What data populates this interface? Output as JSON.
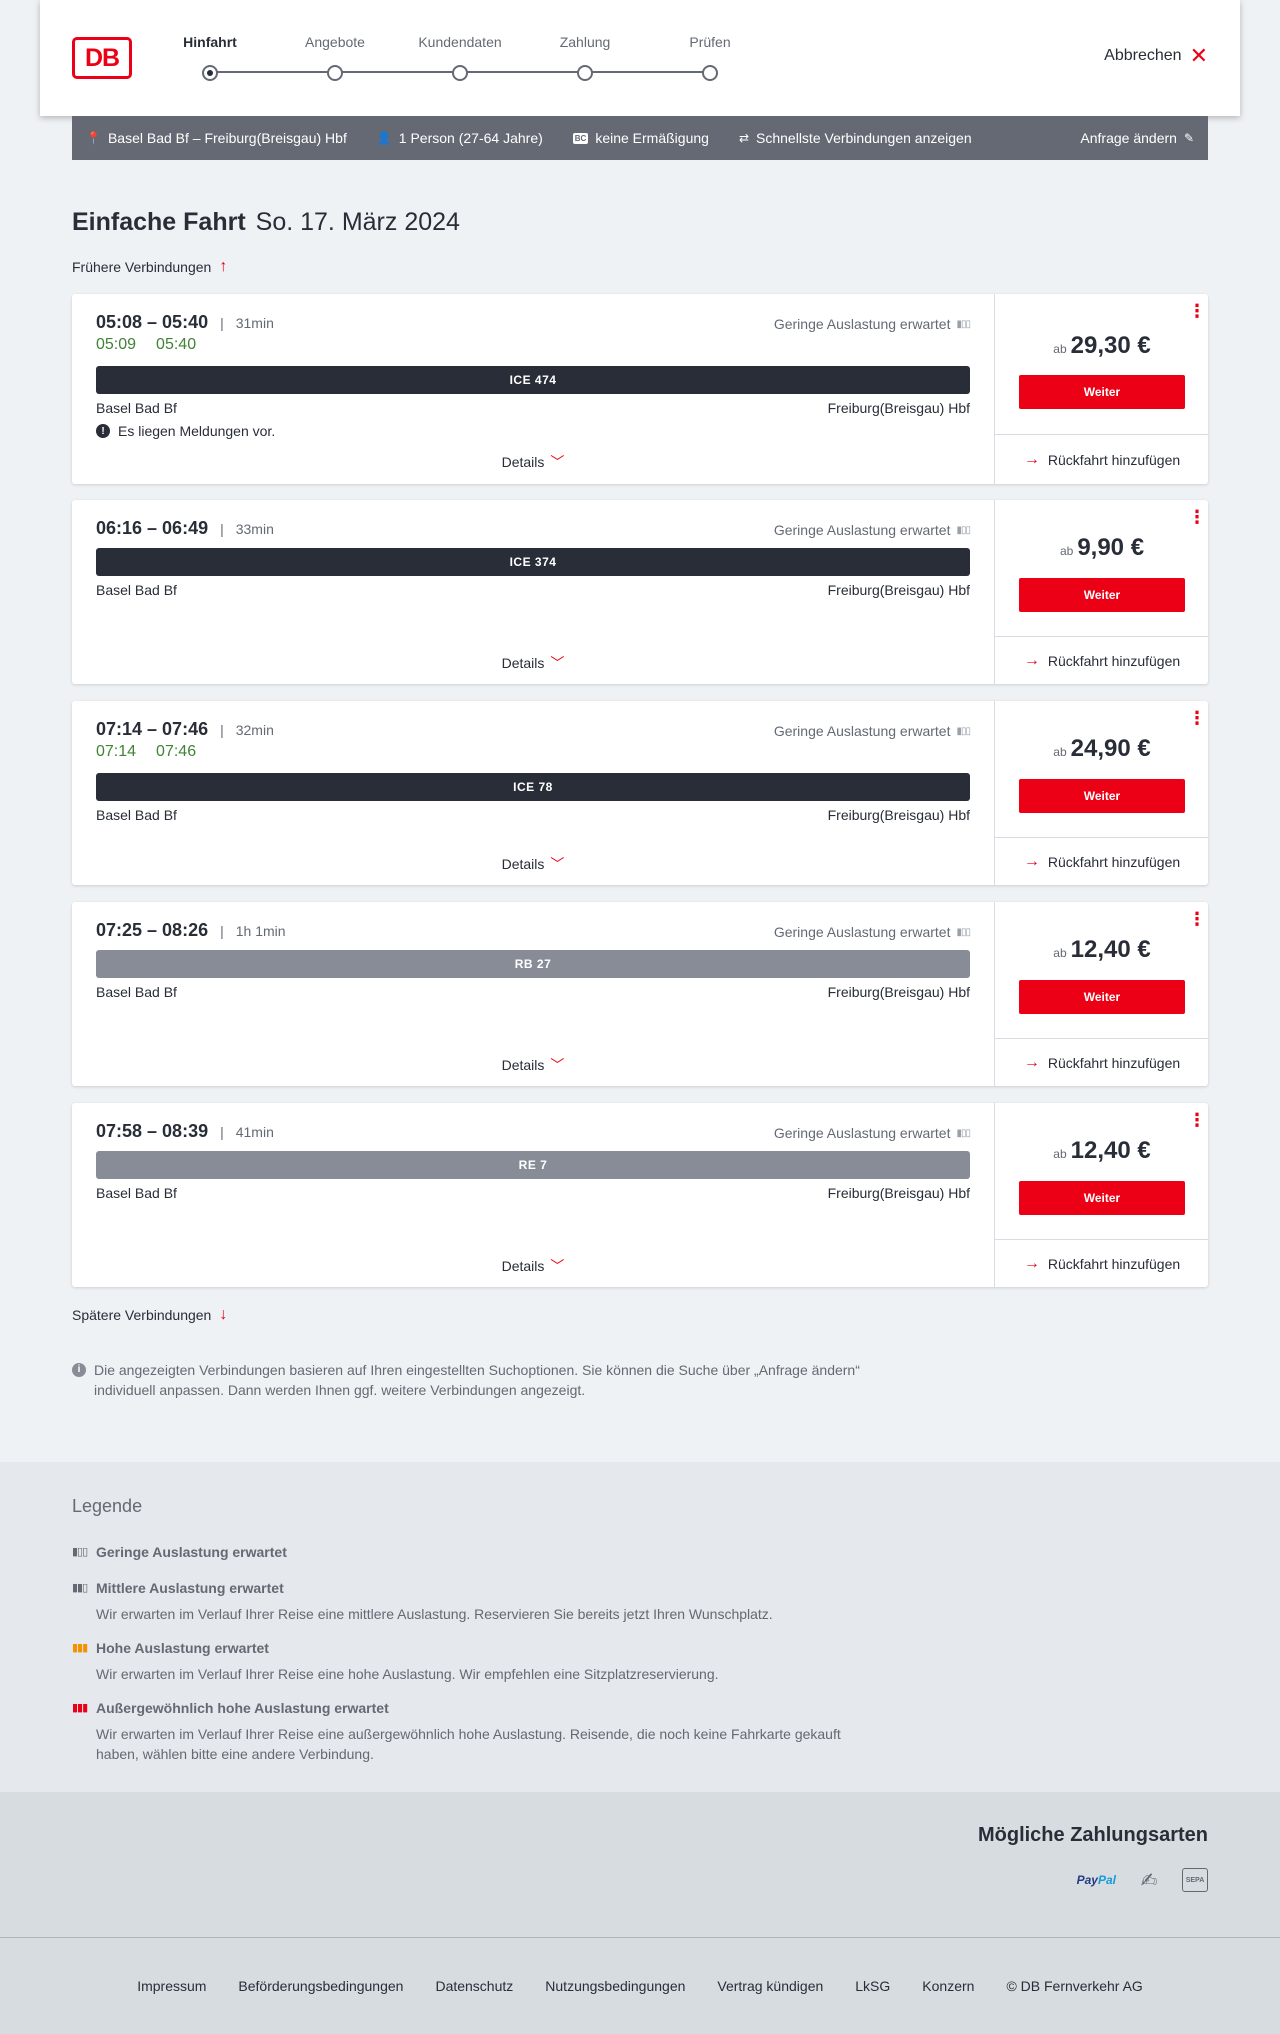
{
  "header": {
    "logo": "DB",
    "steps": [
      {
        "label": "Hinfahrt",
        "active": true
      },
      {
        "label": "Angebote",
        "active": false
      },
      {
        "label": "Kundendaten",
        "active": false
      },
      {
        "label": "Zahlung",
        "active": false
      },
      {
        "label": "Prüfen",
        "active": false
      }
    ],
    "cancel_label": "Abbrechen"
  },
  "searchbar": {
    "route": "Basel Bad Bf – Freiburg(Breisgau) Hbf",
    "passengers": "1 Person (27-64 Jahre)",
    "bahncard_badge": "BC",
    "discount": "keine Ermäßigung",
    "fastest": "Schnellste Verbindungen anzeigen",
    "edit_label": "Anfrage ändern"
  },
  "title": {
    "type": "Einfache Fahrt",
    "date": "So. 17. März 2024"
  },
  "earlier_label": "Frühere Verbindungen",
  "later_label": "Spätere Verbindungen",
  "load_text": "Geringe Auslastung erwartet",
  "details_label": "Details",
  "price_prefix": "ab",
  "continue_label": "Weiter",
  "return_label": "Rückfahrt hinzufügen",
  "connections": [
    {
      "times": "05:08 – 05:40",
      "duration": "31min",
      "rt_dep": "05:09",
      "rt_arr": "05:40",
      "train": "ICE 474",
      "train_style": "dark",
      "from": "Basel Bad Bf",
      "to": "Freiburg(Breisgau) Hbf",
      "message": "Es liegen Meldungen vor.",
      "price": "29,30 €"
    },
    {
      "times": "06:16 – 06:49",
      "duration": "33min",
      "rt_dep": "",
      "rt_arr": "",
      "train": "ICE 374",
      "train_style": "dark",
      "from": "Basel Bad Bf",
      "to": "Freiburg(Breisgau) Hbf",
      "message": "",
      "price": "9,90 €"
    },
    {
      "times": "07:14 – 07:46",
      "duration": "32min",
      "rt_dep": "07:14",
      "rt_arr": "07:46",
      "train": "ICE 78",
      "train_style": "dark",
      "from": "Basel Bad Bf",
      "to": "Freiburg(Breisgau) Hbf",
      "message": "",
      "price": "24,90 €"
    },
    {
      "times": "07:25 – 08:26",
      "duration": "1h 1min",
      "rt_dep": "",
      "rt_arr": "",
      "train": "RB 27",
      "train_style": "grey",
      "from": "Basel Bad Bf",
      "to": "Freiburg(Breisgau) Hbf",
      "message": "",
      "price": "12,40 €"
    },
    {
      "times": "07:58 – 08:39",
      "duration": "41min",
      "rt_dep": "",
      "rt_arr": "",
      "train": "RE 7",
      "train_style": "grey",
      "from": "Basel Bad Bf",
      "to": "Freiburg(Breisgau) Hbf",
      "message": "",
      "price": "12,40 €"
    }
  ],
  "info_note": "Die angezeigten Verbindungen basieren auf Ihren eingestellten Suchoptionen. Sie können die Suche über „Anfrage ändern“ individuell anpassen. Dann werden Ihnen ggf. weitere Verbindungen angezeigt.",
  "legend": {
    "title": "Legende",
    "items": [
      {
        "title": "Geringe Auslastung erwartet",
        "desc": "",
        "color": "#646973"
      },
      {
        "title": "Mittlere Auslastung erwartet",
        "desc": "Wir erwarten im Verlauf Ihrer Reise eine mittlere Auslastung. Reservieren Sie bereits jetzt Ihren Wunschplatz.",
        "color": "#646973"
      },
      {
        "title": "Hohe Auslastung erwartet",
        "desc": "Wir erwarten im Verlauf Ihrer Reise eine hohe Auslastung. Wir empfehlen eine Sitzplatzreservierung.",
        "color": "#f39200"
      },
      {
        "title": "Außergewöhnlich hohe Auslastung erwartet",
        "desc": "Wir erwarten im Verlauf Ihrer Reise eine außergewöhnlich hohe Auslastung. Reisende, die noch keine Fahrkarte gekauft haben, wählen bitte eine andere Verbindung.",
        "color": "#ec0016"
      }
    ]
  },
  "payment": {
    "title": "Mögliche Zahlungsarten",
    "paypal_a": "Pay",
    "paypal_b": "Pal",
    "sepa": "SEPA"
  },
  "footer": [
    "Impressum",
    "Beförderungsbedingungen",
    "Datenschutz",
    "Nutzungsbedingungen",
    "Vertrag kündigen",
    "LkSG",
    "Konzern",
    "© DB Fernverkehr AG"
  ],
  "colors": {
    "accent": "#ec0016",
    "realtime": "#408335",
    "dark": "#282d37"
  }
}
